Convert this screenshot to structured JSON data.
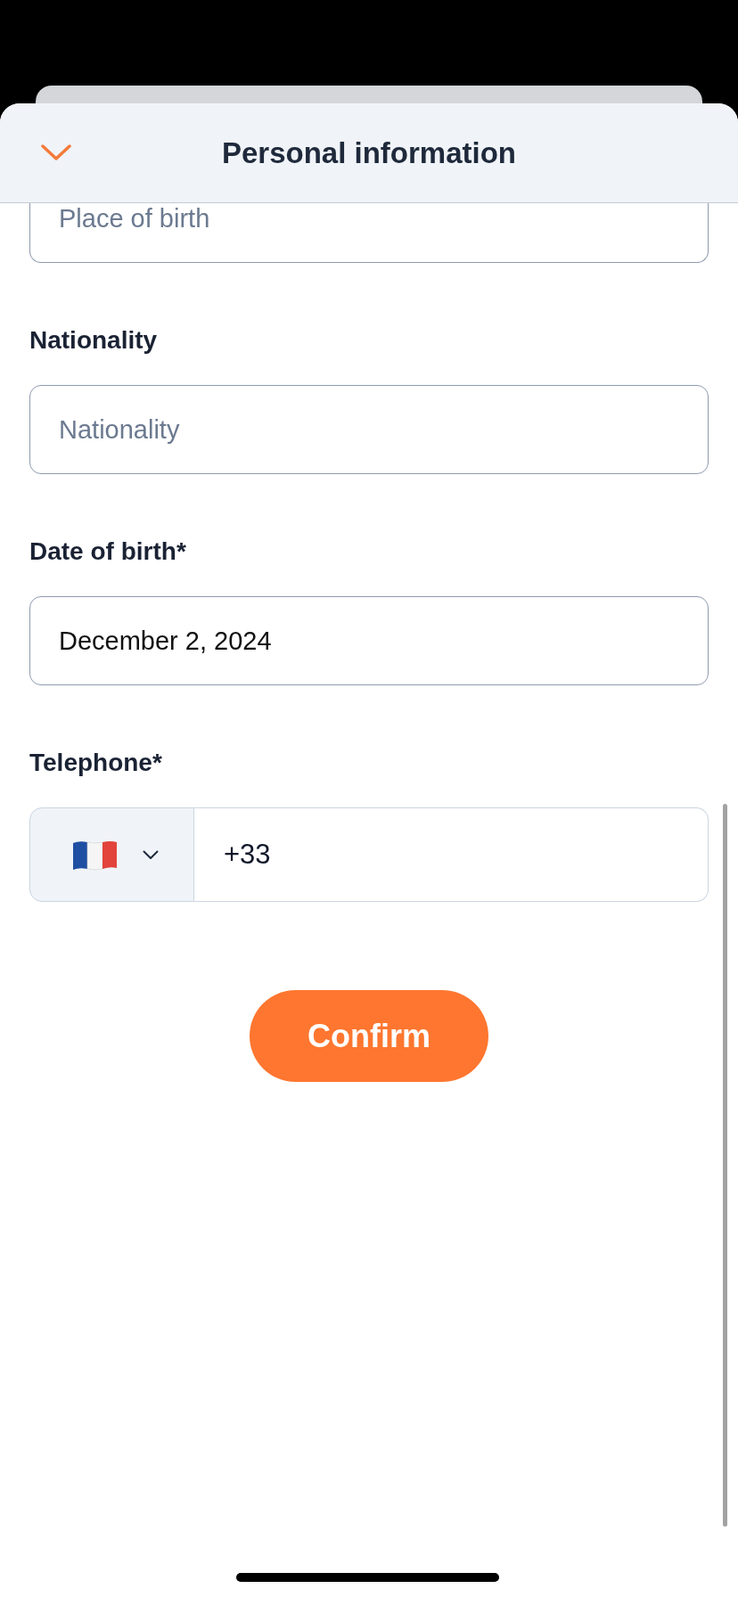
{
  "sheet": {
    "title": "Personal information"
  },
  "fields": [
    {
      "kind": "text",
      "cut_off": true,
      "placeholder": "Place of birth"
    },
    {
      "kind": "text",
      "cut_off": false,
      "label": "Nationality",
      "placeholder": "Nationality"
    },
    {
      "kind": "text",
      "cut_off": false,
      "label": "Date of birth*",
      "value": "December 2, 2024"
    },
    {
      "kind": "phone",
      "cut_off": false,
      "label": "Telephone*",
      "value": "+33"
    }
  ],
  "confirm_button": "Confirm"
}
